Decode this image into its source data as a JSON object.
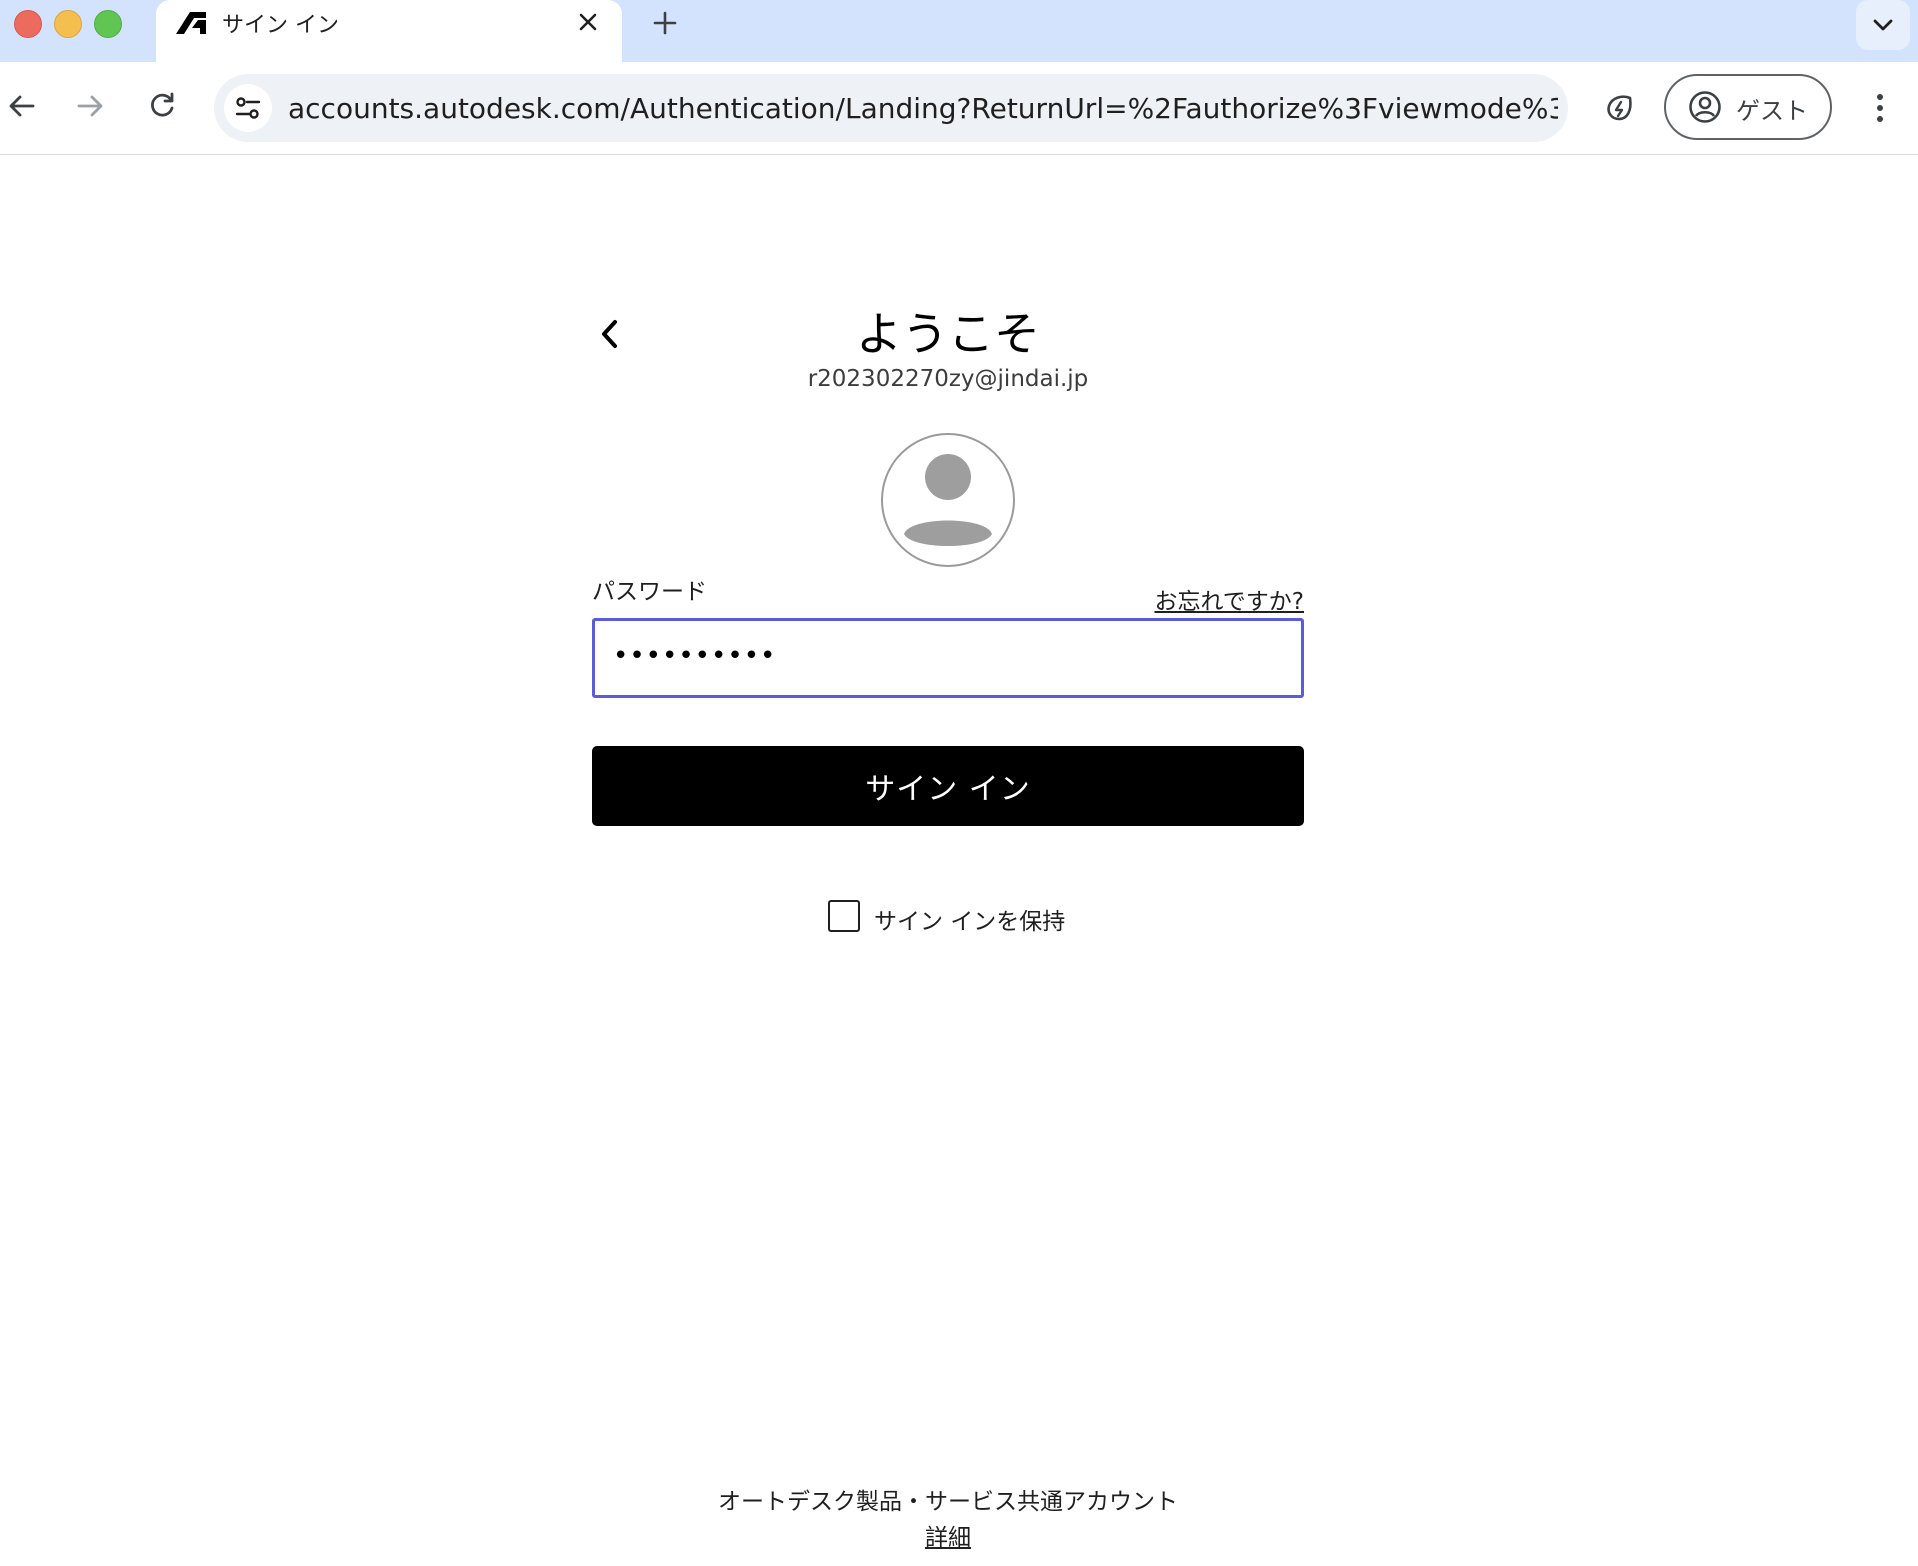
{
  "browser": {
    "tab_title": "サイン イン",
    "url": "accounts.autodesk.com/Authentication/Landing?ReturnUrl=%2Fauthorize%3Fviewmode%3...",
    "profile_label": "ゲスト"
  },
  "login": {
    "title": "ようこそ",
    "email": "r202302270zy@jindai.jp",
    "password_label": "パスワード",
    "forgot_link": "お忘れですか?",
    "password_value": "••••••••••",
    "signin_button": "サイン イン",
    "keep_signed_in_label": "サイン インを保持",
    "keep_signed_in_checked": false
  },
  "footer": {
    "text": "オートデスク製品・サービス共通アカウント",
    "details_link": "詳細"
  },
  "colors": {
    "tabbar_bg": "#d3e3fd",
    "input_focus_border": "#5b5bdb",
    "primary_button": "#000000"
  }
}
